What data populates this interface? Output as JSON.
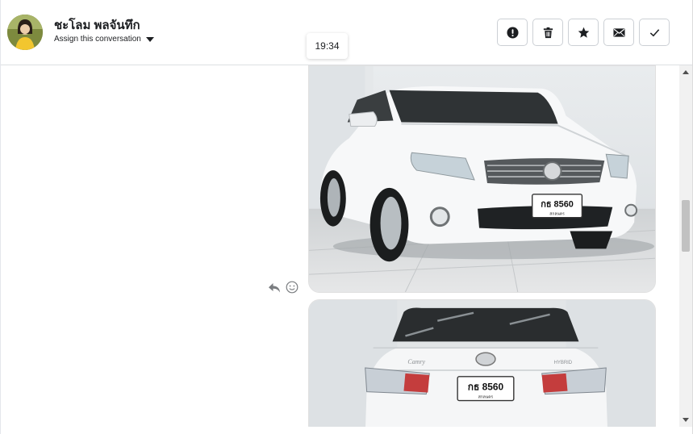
{
  "header": {
    "contact_name": "ชะโลม พลจันทึก",
    "assign_label": "Assign this conversation",
    "actions": [
      {
        "name": "mark-spam-button",
        "icon": "exclamation-icon"
      },
      {
        "name": "delete-button",
        "icon": "trash-icon"
      },
      {
        "name": "star-button",
        "icon": "star-icon"
      },
      {
        "name": "mark-unread-button",
        "icon": "envelope-icon"
      },
      {
        "name": "mark-done-button",
        "icon": "check-icon"
      }
    ]
  },
  "thread": {
    "time_chip": "19:34",
    "messages": [
      {
        "type": "image",
        "plate_text": "กธ 8560",
        "plate_sub": "สกลนคร"
      },
      {
        "type": "image",
        "plate_text": "กธ 8560",
        "plate_sub": "สกลนคร"
      }
    ]
  },
  "colors": {
    "border": "#dddfe2",
    "icon": "#1c1e21"
  }
}
